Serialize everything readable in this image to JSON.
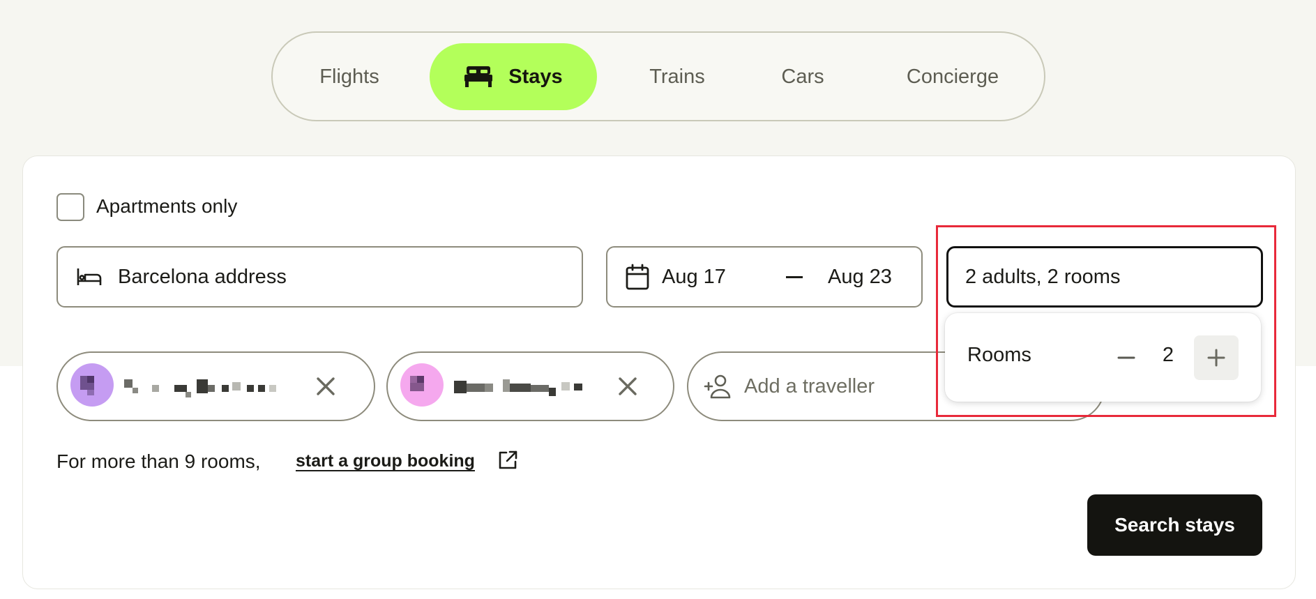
{
  "tabs": [
    {
      "label": "Flights",
      "active": false
    },
    {
      "label": "Stays",
      "active": true,
      "icon": "bed-icon"
    },
    {
      "label": "Trains",
      "active": false
    },
    {
      "label": "Cars",
      "active": false
    },
    {
      "label": "Concierge",
      "active": false
    }
  ],
  "form": {
    "apartments_only_label": "Apartments only",
    "apartments_only_checked": false,
    "location_value": "Barcelona address",
    "date_start": "Aug 17",
    "date_end": "Aug 23",
    "travellers_value": "2 adults, 2 rooms",
    "add_traveller_label": "Add a traveller",
    "group_text": "For more than 9 rooms,",
    "group_link": "start a group booking",
    "search_button": "Search stays"
  },
  "rooms_popover": {
    "label": "Rooms",
    "value": "2"
  },
  "colors": {
    "accent": "#b3ff5a",
    "background_band": "#f6f6f1",
    "button": "#141410",
    "highlight": "#e8293a",
    "avatar_1": "#c59cf2",
    "avatar_2": "#f5a8ee"
  }
}
